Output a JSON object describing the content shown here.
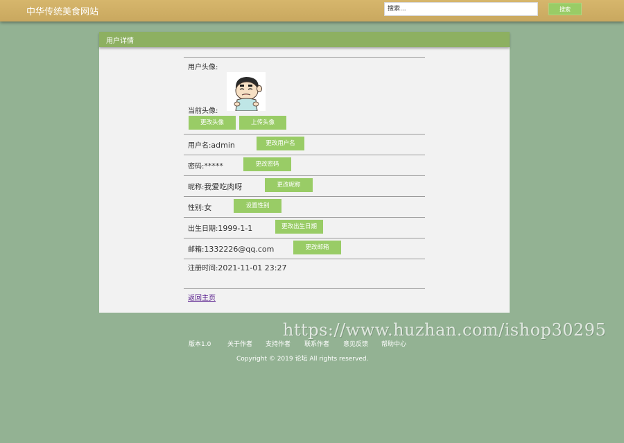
{
  "header": {
    "site_title": "中华传统美食网站",
    "search_placeholder": "搜索...",
    "search_button": "搜索"
  },
  "panel": {
    "title": "用户详情"
  },
  "user": {
    "avatar_label": "用户头像:",
    "current_avatar_label": "当前头像:",
    "change_avatar_button": "更改头像",
    "upload_avatar_button": "上传头像",
    "username_label": "用户名:",
    "username_value": "admin",
    "change_username_button": "更改用户名",
    "password_label": "密码:",
    "password_value": "*****",
    "change_password_button": "更改密码",
    "nickname_label": "昵称:",
    "nickname_value": "我爱吃肉呀",
    "change_nickname_button": "更改昵称",
    "gender_label": "性别:",
    "gender_value": "女",
    "set_gender_button": "设置性别",
    "birthday_label": "出生日期:",
    "birthday_value": "1999-1-1",
    "change_birthday_button": "更改出生日期",
    "email_label": "邮箱:",
    "email_value": "1332226@qq.com",
    "change_email_button": "更改邮箱",
    "register_label": "注册时间:",
    "register_value": "2021-11-01 23:27",
    "back_link": "返回主页"
  },
  "footer": {
    "links": [
      "版本1.0",
      "关于作者",
      "支持作者",
      "联系作者",
      "意见反馈",
      "帮助中心"
    ],
    "copyright": "Copyright © 2019 论坛 All rights reserved."
  },
  "watermark": "https://www.huzhan.com/ishop30295",
  "colors": {
    "header": "#d2b266",
    "panel_header": "#8db061",
    "button": "#99cc66",
    "background": "#93b293"
  }
}
